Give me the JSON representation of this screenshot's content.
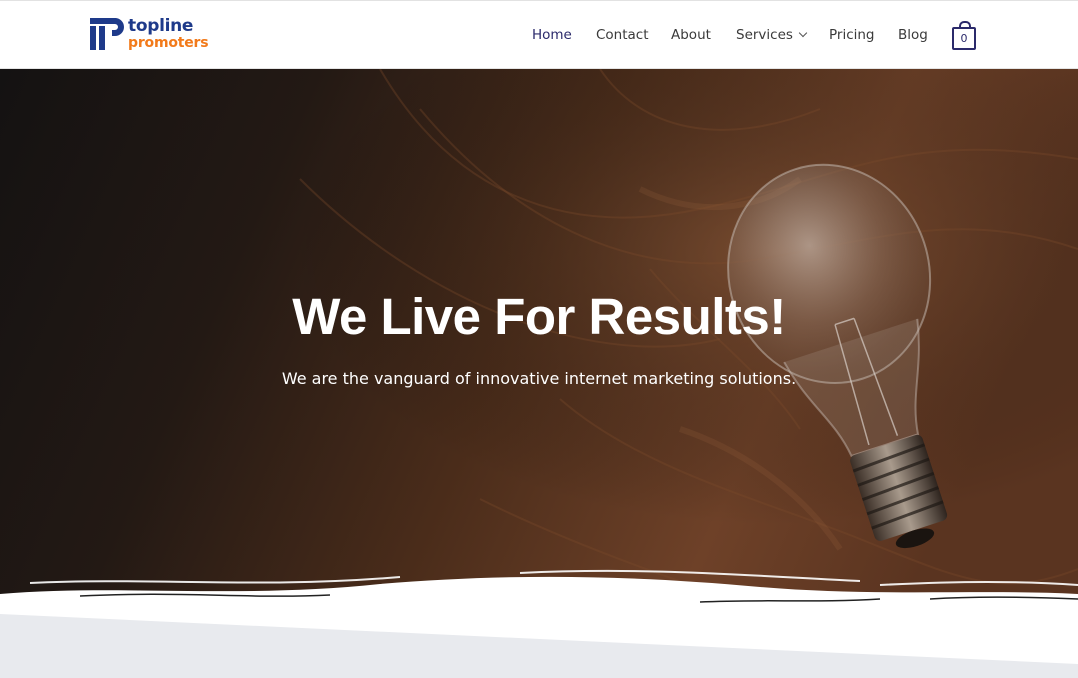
{
  "brand": {
    "word1": "topline",
    "word2": "promoters",
    "primary": "#1e3a8a",
    "accent": "#f27a1a"
  },
  "nav": {
    "home": "Home",
    "contact": "Contact",
    "about": "About",
    "services": "Services",
    "pricing": "Pricing",
    "blog": "Blog",
    "active_color": "#2b2a6b"
  },
  "cart": {
    "count": "0",
    "icon": "shopping-bag-icon"
  },
  "hero": {
    "title": "We Live For Results!",
    "subtitle": "We are the vanguard of innovative internet marketing solutions."
  }
}
